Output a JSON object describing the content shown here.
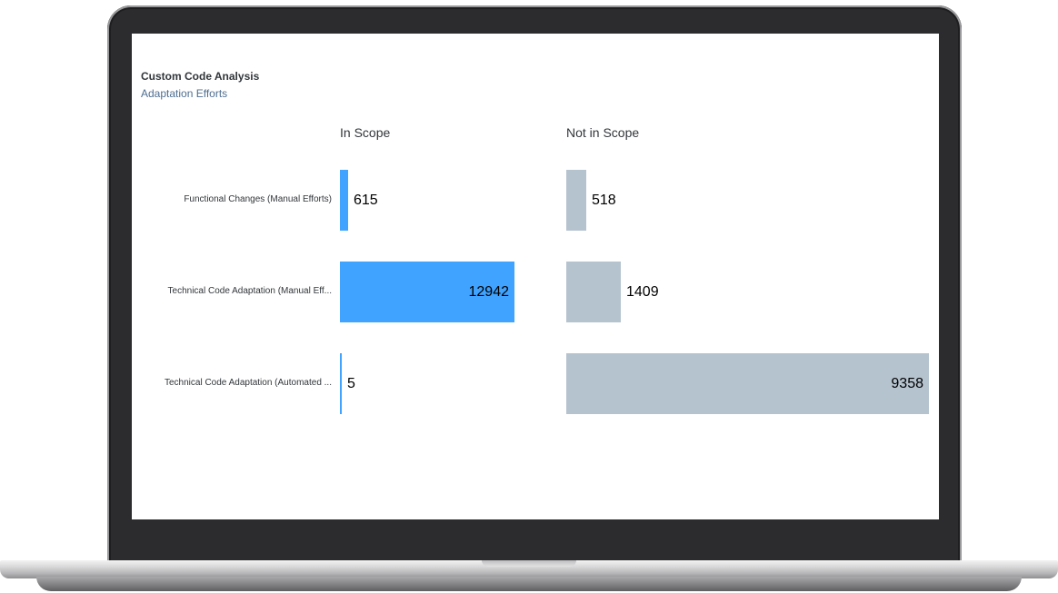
{
  "card": {
    "title": "Custom Code Analysis",
    "subtitle": "Adaptation Efforts"
  },
  "colors": {
    "in_scope": "#3fa3ff",
    "not_in_scope": "#b5c3cf"
  },
  "chart_data": {
    "type": "bar",
    "orientation": "horizontal",
    "layout": "small-multiples",
    "title": "Custom Code Analysis",
    "subtitle": "Adaptation Efforts",
    "categories": [
      "Functional Changes (Manual Efforts)",
      "Technical Code Adaptation (Manual Eff...",
      "Technical Code Adaptation (Automated ..."
    ],
    "series": [
      {
        "name": "In Scope",
        "values": [
          615,
          12942,
          5
        ]
      },
      {
        "name": "Not in Scope",
        "values": [
          518,
          1409,
          9358
        ]
      }
    ],
    "grid": false,
    "legend": "none"
  }
}
